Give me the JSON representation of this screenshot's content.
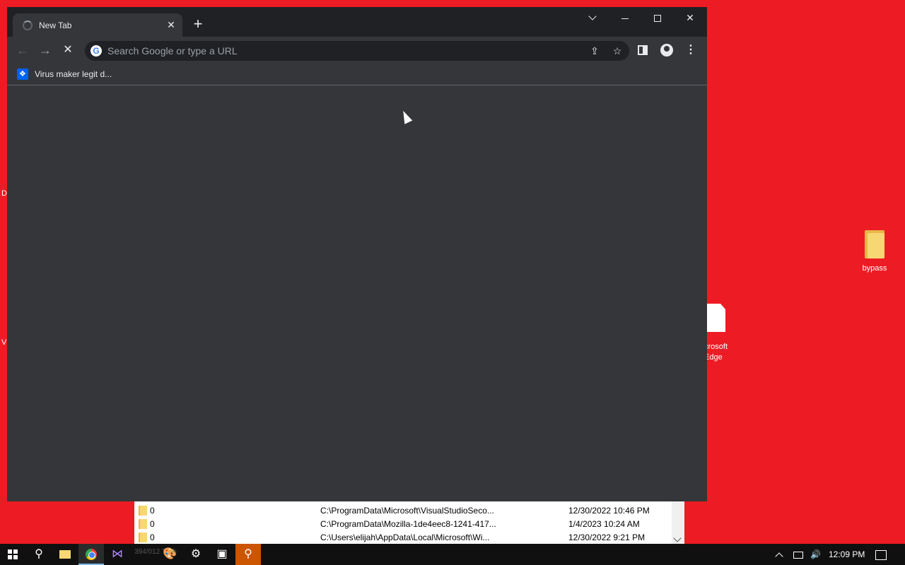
{
  "desktop": {
    "bypass_label": "bypass",
    "edge_label_line1": "crosoft",
    "edge_label_line2": "Edge",
    "frag_d": "D",
    "frag_v": "V"
  },
  "filelist": {
    "rows": [
      {
        "num": "0",
        "path": "C:\\ProgramData\\Microsoft\\VisualStudioSeco...",
        "date": "12/30/2022 10:46 PM"
      },
      {
        "num": "0",
        "path": "C:\\ProgramData\\Mozilla-1de4eec8-1241-417...",
        "date": "1/4/2023 10:24 AM"
      },
      {
        "num": "0",
        "path": "C:\\Users\\elijah\\AppData\\Local\\Microsoft\\Wi...",
        "date": "12/30/2022 9:21 PM"
      }
    ]
  },
  "browser": {
    "tab_title": "New Tab",
    "tab_close": "✕",
    "new_tab": "+",
    "omnibox_placeholder": "Search Google or type a URL",
    "google_letter": "G",
    "bookmark_label": "Virus maker legit d...",
    "window_close": "✕",
    "back": "←",
    "forward": "→",
    "stop": "✕",
    "share": "⇪",
    "star": "☆",
    "menu": "⋮"
  },
  "taskbar": {
    "ghost_text": "394/012  Tech",
    "clock": "12:09 PM",
    "search_glyph": "⚲",
    "settings_glyph": "⚙",
    "vs_glyph": "⋈",
    "paint_glyph": "🎨",
    "app2_glyph": "▣",
    "app3_glyph": "⚲",
    "volume_glyph": "🔊"
  }
}
